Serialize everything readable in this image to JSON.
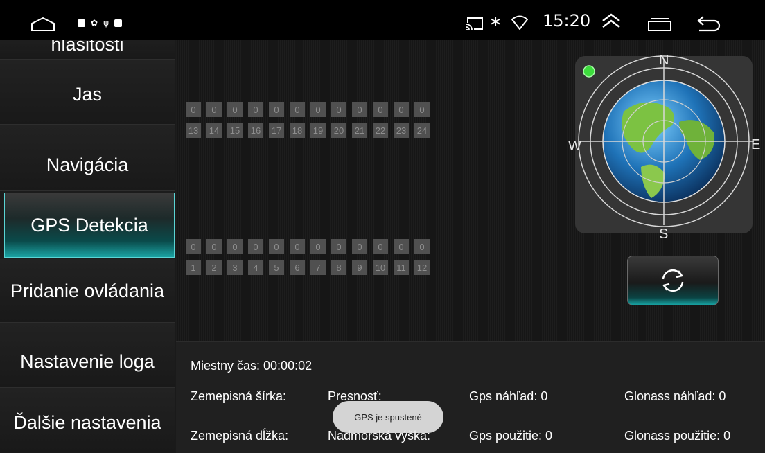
{
  "status_bar": {
    "time": "15:20",
    "icons": [
      "home-icon",
      "notification-icon",
      "settings-icon",
      "usb-icon",
      "notification-icon",
      "cast-icon",
      "bluetooth-icon",
      "wifi-icon",
      "expand-icon",
      "recents-icon",
      "back-icon"
    ]
  },
  "sidebar": {
    "items": [
      {
        "label": "hlasitosti"
      },
      {
        "label": "Jas"
      },
      {
        "label": "Navigácia"
      },
      {
        "label": "GPS Detekcia",
        "active": true
      },
      {
        "label": "Pridanie ovládania"
      },
      {
        "label": "Nastavenie loga"
      },
      {
        "label": "Ďalšie nastavenia"
      }
    ]
  },
  "satellites": {
    "top_values": [
      "0",
      "0",
      "0",
      "0",
      "0",
      "0",
      "0",
      "0",
      "0",
      "0",
      "0",
      "0"
    ],
    "top_ids": [
      "13",
      "14",
      "15",
      "16",
      "17",
      "18",
      "19",
      "20",
      "21",
      "22",
      "23",
      "24"
    ],
    "bottom_values": [
      "0",
      "0",
      "0",
      "0",
      "0",
      "0",
      "0",
      "0",
      "0",
      "0",
      "0",
      "0"
    ],
    "bottom_ids": [
      "1",
      "2",
      "3",
      "4",
      "5",
      "6",
      "7",
      "8",
      "9",
      "10",
      "11",
      "12"
    ]
  },
  "compass": {
    "north": "N",
    "south": "S",
    "east": "E",
    "west": "W",
    "status_color": "#3ddc3d"
  },
  "info": {
    "local_time": "Miestny čas: 00:00:02",
    "latitude": "Zemepisná šírka:",
    "accuracy": "Presnosť:",
    "gps_view": "Gps náhľad: 0",
    "glonass_view": "Glonass náhľad: 0",
    "longitude": "Zemepisná dĺžka:",
    "altitude": "Nadmorská výška:",
    "gps_used": "Gps použitie: 0",
    "glonass_used": "Glonass použitie: 0"
  },
  "toast": "GPS je spustené",
  "colors": {
    "accent": "#1aa3a3",
    "cell": "#505050"
  }
}
